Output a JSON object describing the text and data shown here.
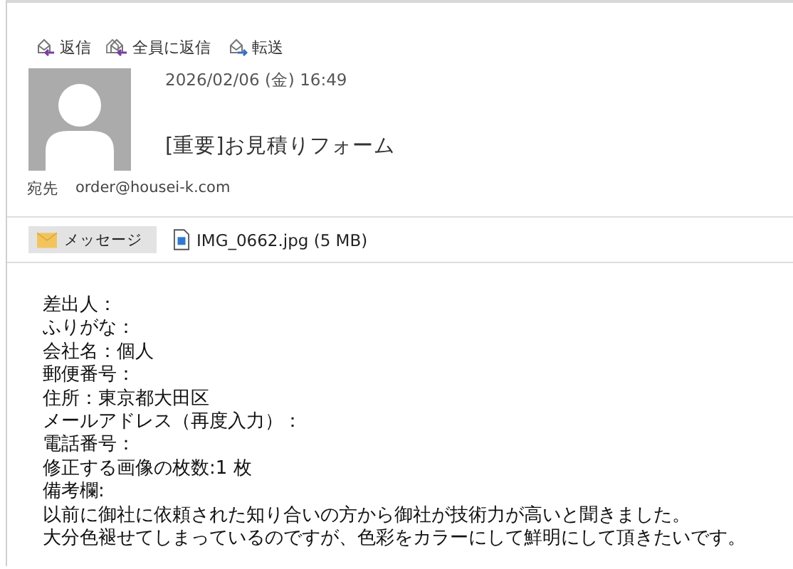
{
  "toolbar": [
    {
      "kind": "reply",
      "label": "返信"
    },
    {
      "kind": "reply_all",
      "label": "全員に返信"
    },
    {
      "kind": "forward",
      "label": "転送"
    }
  ],
  "message": {
    "date": "2026/02/06 (金) 16:49",
    "subject": "[重要]お見積りフォーム",
    "to_label": "宛先",
    "to": "order@housei-k.com"
  },
  "attachments": [
    {
      "kind": "message",
      "label": "メッセージ",
      "selected": true
    },
    {
      "kind": "image",
      "label": "IMG_0662.jpg (5 MB)",
      "selected": false
    }
  ],
  "body": [
    "差出人：",
    "ふりがな：",
    "会社名：個人",
    "郵便番号：",
    "住所：東京都大田区",
    "メールアドレス（再度入力）：",
    "電話番号：",
    "修正する画像の枚数:1 枚",
    "備考欄:",
    "以前に御社に依頼された知り合いの方から御社が技術力が高いと聞きました。",
    "大分色褪せてしまっているのですが、色彩をカラーにして鮮明にして頂きたいです。"
  ]
}
